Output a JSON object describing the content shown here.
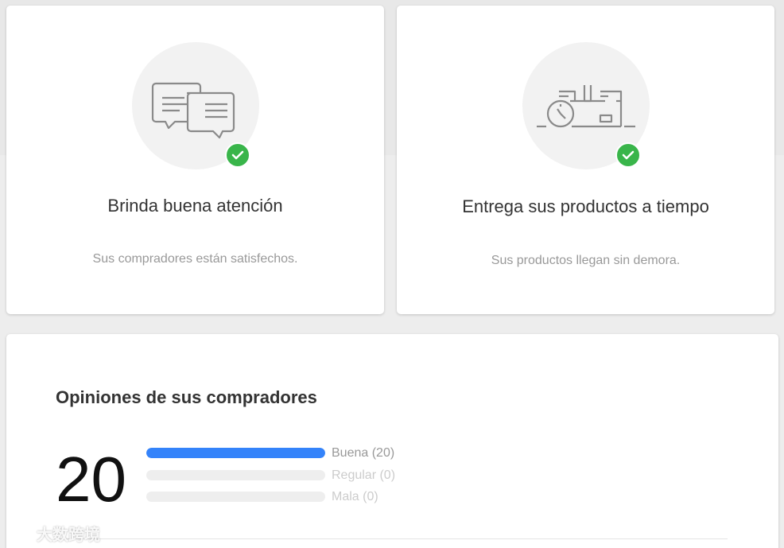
{
  "colors": {
    "accent_blue": "#3483fa",
    "check_green": "#39b54a",
    "muted_text": "#999999",
    "bar_track": "#eeeeee"
  },
  "cards": {
    "attention": {
      "icon": "chat-bubbles-icon",
      "title": "Brinda buena atención",
      "subtitle": "Sus compradores están satisfechos."
    },
    "delivery": {
      "icon": "delivery-clock-icon",
      "title": "Entrega sus productos a tiempo",
      "subtitle": "Sus productos llegan sin demora."
    }
  },
  "opinions": {
    "title": "Opiniones de sus compradores",
    "total": "20",
    "rows": [
      {
        "label": "Buena (20)",
        "fraction": 1.0,
        "color": "#3483fa",
        "label_color": "#999999"
      },
      {
        "label": "Regular (0)",
        "fraction": 0.0,
        "color": "#3483fa",
        "label_color": "#cccccc"
      },
      {
        "label": "Mala (0)",
        "fraction": 0.0,
        "color": "#3483fa",
        "label_color": "#cccccc"
      }
    ]
  },
  "watermark": {
    "text": "大数跨境"
  }
}
